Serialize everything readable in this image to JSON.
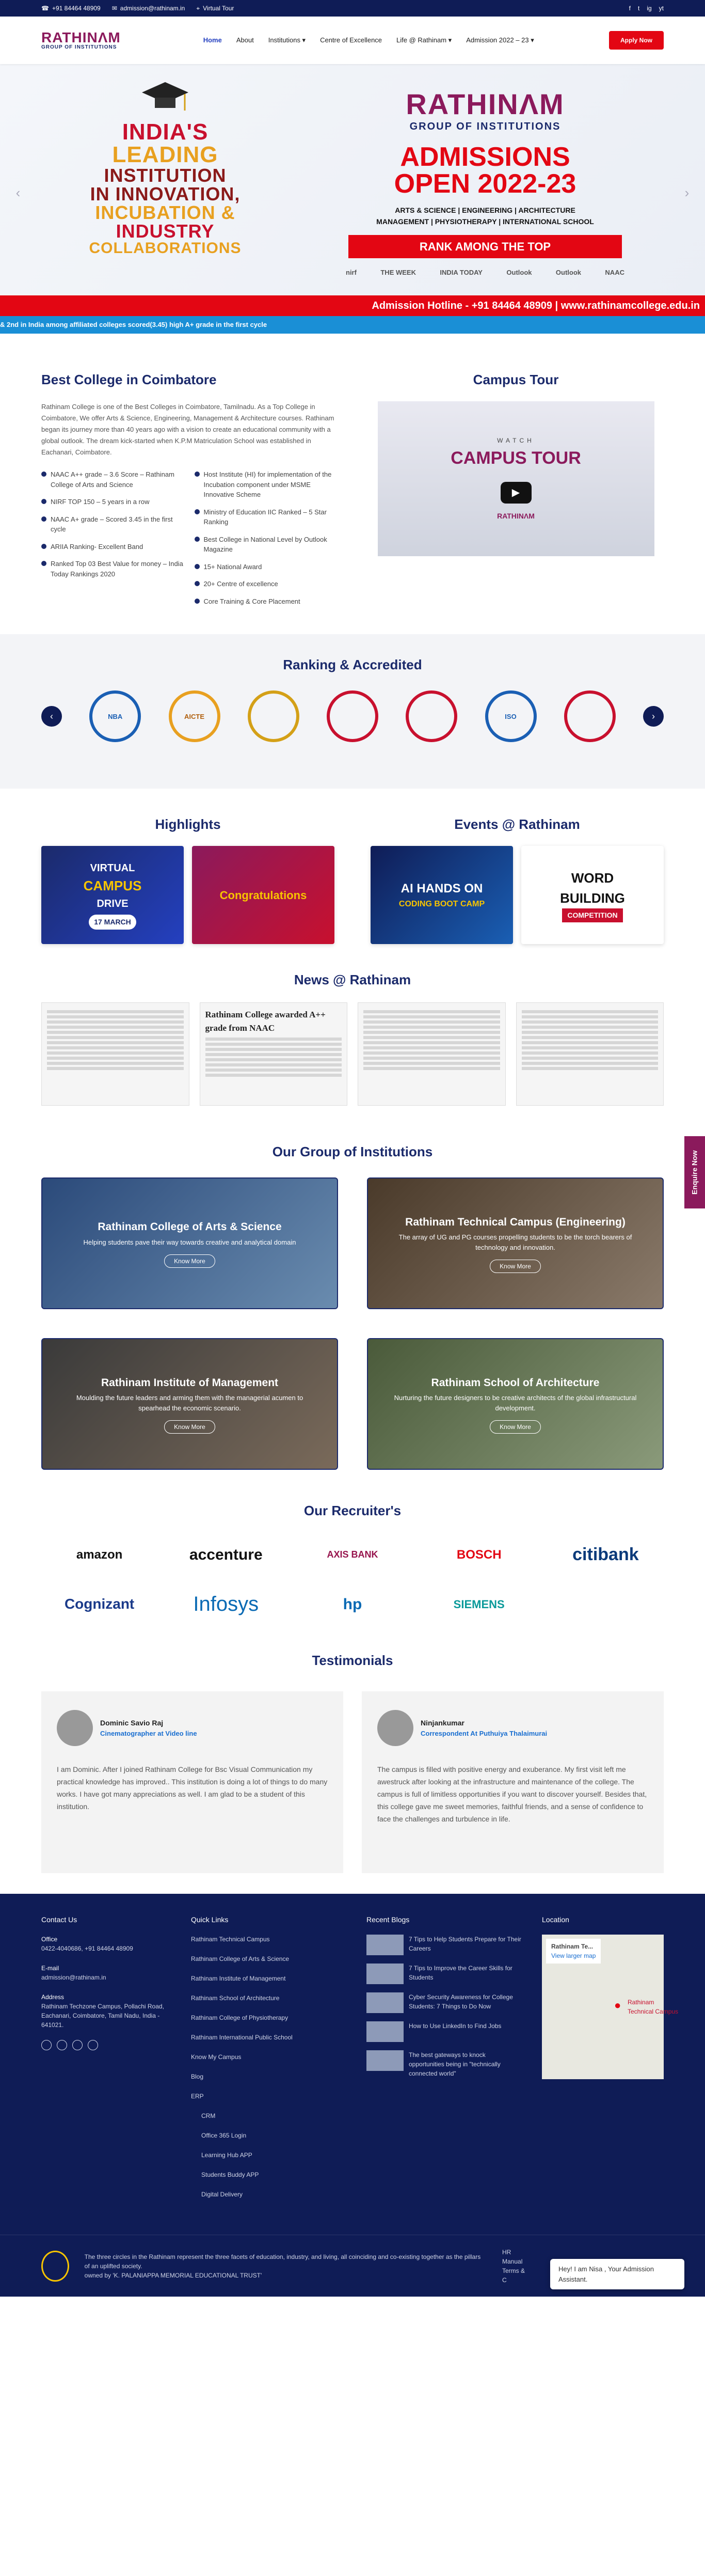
{
  "topbar": {
    "phone": "+91 84464 48909",
    "email": "admission@rathinam.in",
    "tour": "Virtual Tour",
    "social": [
      "f",
      "t",
      "ig",
      "yt"
    ]
  },
  "header": {
    "logo_main": "RATHINΛM",
    "logo_sub": "GROUP OF INSTITUTIONS",
    "nav": [
      "Home",
      "About",
      "Institutions ▾",
      "Centre of Excellence",
      "Life @ Rathinam ▾",
      "Admission 2022 – 23 ▾"
    ],
    "apply": "Apply Now"
  },
  "hero": {
    "left_lines": [
      "INDIA'S",
      "LEADING",
      "INSTITUTION",
      "IN INNOVATION,",
      "INCUBATION &",
      "INDUSTRY",
      "COLLABORATIONS"
    ],
    "brand": "RATHINΛM",
    "group": "GROUP OF INSTITUTIONS",
    "admissions": "ADMISSIONS",
    "open": "OPEN 2022-23",
    "streams1": "ARTS & SCIENCE | ENGINEERING | ARCHITECTURE",
    "streams2": "MANAGEMENT | PHYSIOTHERAPY | INTERNATIONAL SCHOOL",
    "rank": "RANK AMONG THE TOP",
    "logos": [
      "nirf",
      "THE WEEK",
      "INDIA TODAY",
      "Outlook",
      "Outlook",
      "NAAC"
    ],
    "band": "Admission Hotline - +91 84464 48909  |  www.rathinamcollege.edu.in"
  },
  "ticker": "& 2nd in India among affiliated colleges scored(3.45) high A+ grade in the first cycle",
  "about": {
    "title": "Best College in Coimbatore",
    "text": "Rathinam College is one of the Best Colleges in Coimbatore, Tamilnadu. As a Top College in Coimbatore, We offer Arts & Science, Engineering, Management & Architecture courses. Rathinam began its journey more than 40 years ago with a vision to create an educational community with a global outlook. The dream kick-started when K.P.M Matriculation School was established in Eachanari, Coimbatore.",
    "list_left": [
      "NAAC A++ grade – 3.6 Score – Rathinam College of Arts and Science",
      "NIRF TOP 150 – 5 years in a row",
      "NAAC A+ grade – Scored 3.45 in the first cycle",
      "ARIIA Ranking- Excellent Band",
      "Ranked Top 03 Best Value for money – India Today Rankings 2020"
    ],
    "list_right": [
      "Host Institute (HI) for implementation of the Incubation component under MSME Innovative Scheme",
      "Ministry of Education IIC Ranked – 5 Star Ranking",
      "Best College in National Level by Outlook Magazine",
      "15+ National Award",
      "20+ Centre of excellence",
      "Core Training & Core Placement"
    ]
  },
  "tour": {
    "title": "Campus Tour",
    "watch": "WATCH",
    "campus": "CAMPUS TOUR",
    "brand": "RATHINΛM"
  },
  "ranking": {
    "title": "Ranking & Accredited",
    "badges": [
      "NBA",
      "AICTE",
      "",
      "",
      "",
      "ISO",
      ""
    ]
  },
  "highlights": {
    "title": "Highlights",
    "card1_a": "VIRTUAL",
    "card1_b": "CAMPUS",
    "card1_c": "DRIVE",
    "card1_d": "17 MARCH",
    "card2": "Congratulations"
  },
  "events": {
    "title": "Events @ Rathinam",
    "card1_a": "AI HANDS ON",
    "card1_b": "CODING BOOT CAMP",
    "card2_a": "WORD",
    "card2_b": "BUILDING",
    "card2_c": "COMPETITION"
  },
  "news": {
    "title": "News @ Rathinam",
    "headline": "Rathinam College awarded A++ grade from NAAC"
  },
  "group": {
    "title": "Our Group of Institutions",
    "items": [
      {
        "name": "Rathinam College of Arts & Science",
        "desc": "Helping students pave their way towards creative and analytical domain",
        "btn": "Know More"
      },
      {
        "name": "Rathinam Technical Campus (Engineering)",
        "desc": "The array of UG and PG courses propelling students to be the torch bearers of technology and innovation.",
        "btn": "Know More"
      },
      {
        "name": "Rathinam Institute of Management",
        "desc": "Moulding the future leaders and arming them with the managerial acumen to spearhead the economic scenario.",
        "btn": "Know More"
      },
      {
        "name": "Rathinam School of Architecture",
        "desc": "Nurturing the future designers to be creative architects of the global infrastructural development.",
        "btn": "Know More"
      }
    ]
  },
  "recruiters": {
    "title": "Our Recruiter's",
    "row1": [
      "amazon",
      "accenture",
      "AXIS BANK",
      "BOSCH",
      "citibank"
    ],
    "row2": [
      "Cognizant",
      "Infosys",
      "hp",
      "SIEMENS"
    ]
  },
  "testimonials": {
    "title": "Testimonials",
    "items": [
      {
        "name": "Dominic Savio Raj",
        "role": "Cinematographer at Video line",
        "text": "I am Dominic. After I joined Rathinam College for Bsc Visual Communication my practical knowledge has improved.. This institution is doing a lot of things to do many works. I have got many appreciations as well. I am glad to be a student of this institution."
      },
      {
        "name": "Ninjankumar",
        "role": "Correspondent At Puthuiya Thalaimurai",
        "text": "The campus is filled with positive energy and exuberance. My first visit left me awestruck after looking at the infrastructure and maintenance of the college. The campus is full of limitless opportunities if you want to discover yourself. Besides that, this college gave me sweet memories, faithful friends, and a sense of confidence to face the challenges and turbulence in life."
      }
    ]
  },
  "footer": {
    "contact_title": "Contact Us",
    "office_label": "Office",
    "office": "0422-4040686, +91 84464 48909",
    "email_label": "E-mail",
    "email": "admission@rathinam.in",
    "address_label": "Address",
    "address": "Rathinam Techzone Campus, Pollachi Road, Eachanari, Coimbatore, Tamil Nadu, India - 641021.",
    "links_title": "Quick Links",
    "links": [
      "Rathinam Technical Campus",
      "Rathinam College of Arts & Science",
      "Rathinam Institute of Management",
      "Rathinam School of Architecture",
      "Rathinam College of Physiotherapy",
      "Rathinam International Public School",
      "Know My Campus",
      "Blog",
      "ERP"
    ],
    "erp_sub": [
      "CRM",
      "Office 365 Login",
      "Learning Hub APP",
      "Students Buddy APP",
      "Digital Delivery"
    ],
    "blogs_title": "Recent Blogs",
    "blogs": [
      "7 Tips to Help Students Prepare for Their Careers",
      "7 Tips to Improve the Career Skills for Students",
      "Cyber Security Awareness for College Students: 7 Things to Do Now",
      "How to Use LinkedIn to Find Jobs",
      "The best gateways to knock opportunities being in \"technically connected world\""
    ],
    "location_title": "Location",
    "map_label": "Rathinam Te...",
    "map_link": "View larger map",
    "map_pin": "Rathinam Technical Campus",
    "bottom_text": "The three circles in the Rathinam represent the three facets of education, industry, and living, all coinciding and co-existing together as the pillars of an uplifted society.",
    "bottom_text2": "owned by 'K. PALANIAPPA MEMORIAL EDUCATIONAL TRUST'",
    "hr": "HR Manual",
    "terms": "Terms & C",
    "chat": "Hey! I am Nisa , Your Admission Assistant."
  },
  "enquire": "Enquire Now"
}
